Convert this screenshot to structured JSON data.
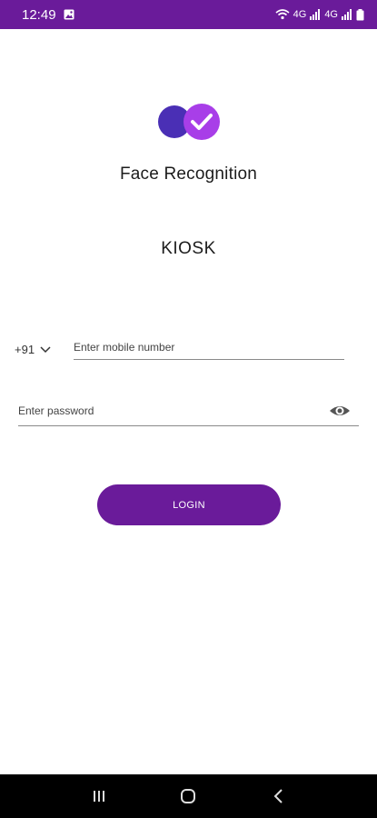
{
  "status_bar": {
    "time": "12:49",
    "network_left": "4G",
    "network_right": "4G",
    "icons": [
      "gallery-icon",
      "wifi-icon",
      "signal-icon",
      "signal-icon",
      "battery-icon"
    ],
    "background": "#6a1b9a"
  },
  "logo": {
    "icon": "face-check-logo",
    "colors": {
      "left_circle": "#4a2fb5",
      "right_circle": "#a83ee8",
      "check": "#ffffff"
    }
  },
  "app": {
    "title": "Face Recognition",
    "subtitle": "KIOSK"
  },
  "form": {
    "country_code": "+91",
    "mobile_placeholder": "Enter mobile number",
    "mobile_value": "",
    "password_placeholder": "Enter password",
    "password_value": "",
    "login_label": "LOGIN",
    "accent": "#6a1b9a"
  },
  "nav_bar": {
    "buttons": [
      "recent-apps-icon",
      "home-icon",
      "back-icon"
    ]
  }
}
